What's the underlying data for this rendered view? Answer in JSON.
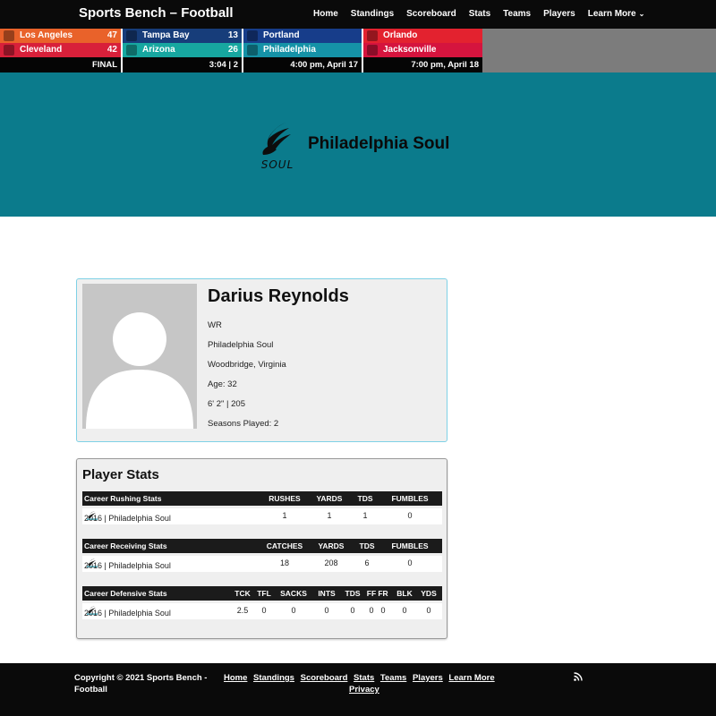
{
  "header": {
    "site_title": "Sports Bench – Football",
    "nav": [
      "Home",
      "Standings",
      "Scoreboard",
      "Stats",
      "Teams",
      "Players",
      "Learn More"
    ]
  },
  "scoreboard": {
    "games": [
      {
        "teams": [
          {
            "name": "Los Angeles",
            "score": "47",
            "color": "#e9622a"
          },
          {
            "name": "Cleveland",
            "score": "42",
            "color": "#d8203a"
          }
        ],
        "status": "FINAL"
      },
      {
        "teams": [
          {
            "name": "Tampa Bay",
            "score": "13",
            "color": "#173d7a"
          },
          {
            "name": "Arizona",
            "score": "26",
            "color": "#17a7a0"
          }
        ],
        "status": "3:04 | 2"
      },
      {
        "teams": [
          {
            "name": "Portland",
            "score": "",
            "color": "#173d8a"
          },
          {
            "name": "Philadelphia",
            "score": "",
            "color": "#1592a7"
          }
        ],
        "status": "4:00 pm, April 17"
      },
      {
        "teams": [
          {
            "name": "Orlando",
            "score": "",
            "color": "#e3222f"
          },
          {
            "name": "Jacksonville",
            "score": "",
            "color": "#d5143e"
          }
        ],
        "status": "7:00 pm, April 18"
      }
    ]
  },
  "team": {
    "name": "Philadelphia Soul",
    "logo_text": "SOUL",
    "hero_color": "#0b7b8c"
  },
  "player": {
    "name": "Darius Reynolds",
    "position": "WR",
    "team": "Philadelphia Soul",
    "hometown": "Woodbridge, Virginia",
    "age": "Age: 32",
    "size": "6' 2\" | 205",
    "seasons": "Seasons Played: 2"
  },
  "stats": {
    "title": "Player Stats",
    "rushing": {
      "headers": [
        "Career Rushing Stats",
        "RUSHES",
        "YARDS",
        "TDS",
        "FUMBLES"
      ],
      "row": [
        "2016 | Philadelphia Soul",
        "1",
        "1",
        "1",
        "0"
      ]
    },
    "receiving": {
      "headers": [
        "Career Receiving Stats",
        "CATCHES",
        "YARDS",
        "TDS",
        "FUMBLES"
      ],
      "row": [
        "2016 | Philadelphia Soul",
        "18",
        "208",
        "6",
        "0"
      ]
    },
    "defensive": {
      "headers": [
        "Career Defensive Stats",
        "TCK",
        "TFL",
        "SACKS",
        "INTS",
        "TDS",
        "FF",
        "FR",
        "BLK",
        "YDS"
      ],
      "row": [
        "2016 | Philadelphia Soul",
        "2.5",
        "0",
        "0",
        "0",
        "0",
        "0",
        "0",
        "0",
        "0"
      ]
    }
  },
  "footer": {
    "copyright": "Copyright © 2021 Sports Bench - Football",
    "links": [
      "Home",
      "Standings",
      "Scoreboard",
      "Stats",
      "Teams",
      "Players",
      "Learn More",
      "Privacy"
    ]
  }
}
